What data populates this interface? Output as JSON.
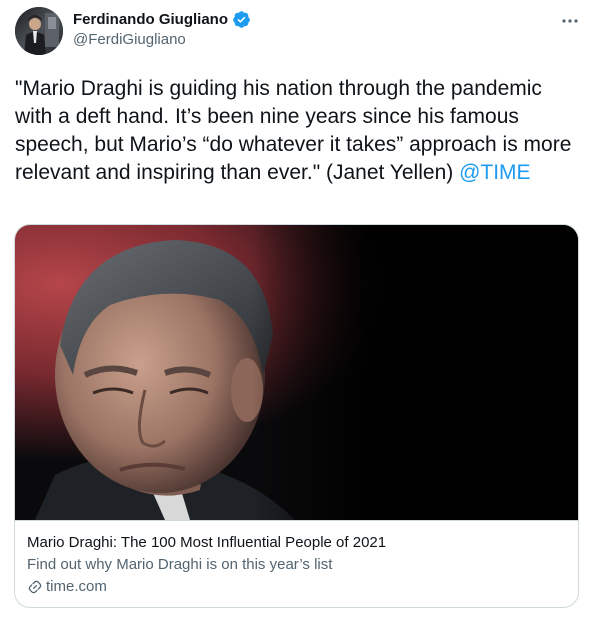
{
  "author": {
    "display_name": "Ferdinando Giugliano",
    "handle": "@FerdiGiugliano",
    "verified": true,
    "verified_color": "#1d9bf0"
  },
  "tweet": {
    "text": "\"Mario Draghi is guiding his nation through the pandemic with a deft hand. It’s been nine years since his famous speech, but Mario’s “do whatever it takes” approach is more relevant and inspiring than ever.\" (Janet Yellen) ",
    "mention": "@TIME",
    "mention_color": "#1d9bf0"
  },
  "card": {
    "title": "Mario Draghi: The 100 Most Influential People of 2021",
    "description": "Find out why Mario Draghi is on this year’s list",
    "domain": "time.com"
  },
  "icons": {
    "verified": "verified-badge-icon",
    "more": "more-options-icon",
    "link": "link-icon"
  }
}
